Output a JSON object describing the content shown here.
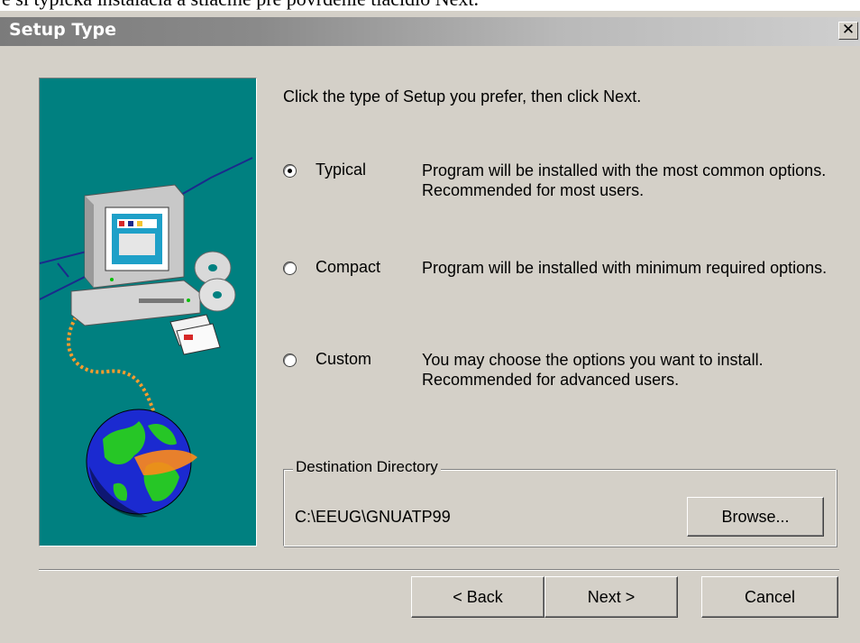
{
  "doc_fragment": "e si typická inštalácia a stlačme pre povrdenie tlačidlo Next.",
  "window": {
    "title": "Setup Type",
    "close_glyph": "✕"
  },
  "prompt": "Click the type of Setup you prefer, then click Next.",
  "setup_options": [
    {
      "label": "Typical",
      "description": "Program will be installed with the most common options. Recommended for most users.",
      "selected": true
    },
    {
      "label": "Compact",
      "description": "Program will be installed with minimum required options.",
      "selected": false
    },
    {
      "label": "Custom",
      "description": "You may choose the options you want to install. Recommended for advanced users.",
      "selected": false
    }
  ],
  "destination": {
    "legend": "Destination Directory",
    "path": "C:\\EEUG\\GNUATP99",
    "browse_label": "Browse..."
  },
  "buttons": {
    "back": "< Back",
    "next": "Next >",
    "cancel": "Cancel"
  },
  "colors": {
    "dialog_bg": "#d4d0c8",
    "art_bg": "#008080",
    "titlebar_start": "#7b7b7b",
    "titlebar_end": "#cfcfcf"
  },
  "icons": {
    "art": "computer-with-globe-illustration",
    "close": "close-icon"
  }
}
